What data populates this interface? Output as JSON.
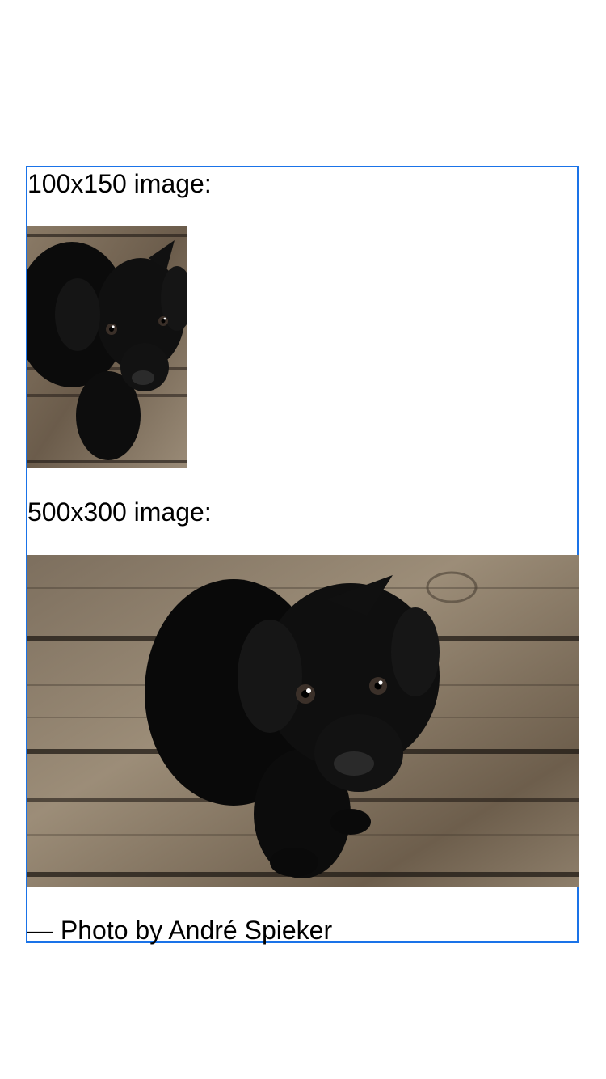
{
  "labels": {
    "small_image": "100x150 image:",
    "large_image": "500x300 image:",
    "credit": "— Photo by André Spieker"
  },
  "images": {
    "small": {
      "description": "puppy-photo",
      "width": 100,
      "height": 150
    },
    "large": {
      "description": "puppy-photo",
      "width": 500,
      "height": 300
    }
  },
  "colors": {
    "frame_border": "#1a73e8",
    "text": "#000000"
  }
}
